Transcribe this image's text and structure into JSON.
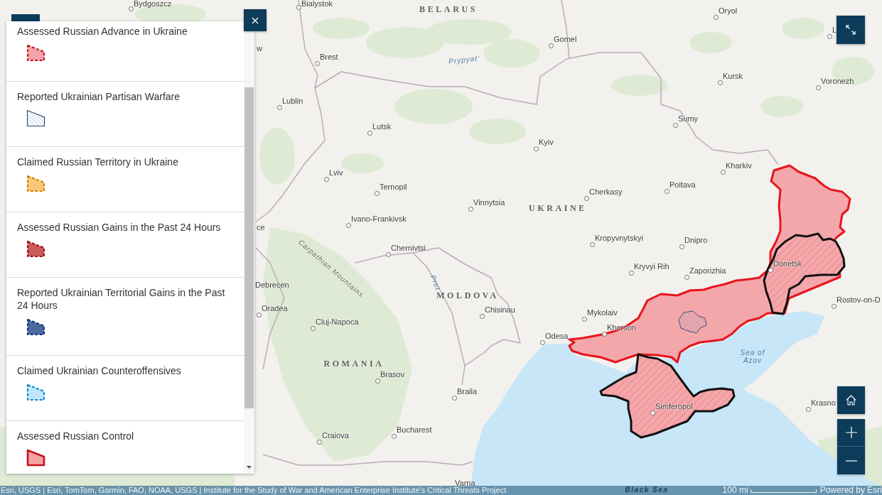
{
  "legend": {
    "items": [
      {
        "label": "Assessed Russian Advance in Ukraine",
        "kind": "dashed",
        "color": "#f4a4a9"
      },
      {
        "label": "Reported Ukrainian Partisan Warfare",
        "kind": "hatched",
        "color": "#344e73"
      },
      {
        "label": "Claimed Russian Territory in Ukraine",
        "kind": "dashed",
        "color": "#fbc776"
      },
      {
        "label": "Assessed Russian Gains in the Past 24 Hours",
        "kind": "dashed",
        "color": "#c95b5d"
      },
      {
        "label": "Reported Ukrainian Territorial Gains in the Past 24 Hours",
        "kind": "dashed",
        "color": "#4d6a9e"
      },
      {
        "label": "Claimed Ukrainian Counteroffensives",
        "kind": "dashed",
        "color": "#bfe6fb"
      },
      {
        "label": "Assessed Russian Control",
        "kind": "solid",
        "color": "#f6a3a6"
      }
    ]
  },
  "map": {
    "labels": [
      {
        "kind": "city",
        "text": "Bydgoszcz"
      },
      {
        "kind": "city",
        "text": "Bialystok"
      },
      {
        "kind": "country",
        "text": "BELARUS"
      },
      {
        "kind": "city",
        "text": "Oryol"
      },
      {
        "kind": "city",
        "text": "L"
      },
      {
        "kind": "city",
        "text": "Gomel"
      },
      {
        "kind": "cut",
        "text": "w"
      },
      {
        "kind": "city",
        "text": "Brest"
      },
      {
        "kind": "water",
        "text": "Prypyat'"
      },
      {
        "kind": "city",
        "text": "Kursk"
      },
      {
        "kind": "city",
        "text": "Voronezh"
      },
      {
        "kind": "city",
        "text": "Lublin"
      },
      {
        "kind": "city",
        "text": "Sumy"
      },
      {
        "kind": "city",
        "text": "Lutsk"
      },
      {
        "kind": "city",
        "text": "Kyiv"
      },
      {
        "kind": "city",
        "text": "Kharkiv"
      },
      {
        "kind": "city",
        "text": "Lviv"
      },
      {
        "kind": "city",
        "text": "Poltava"
      },
      {
        "kind": "city",
        "text": "Ternopil"
      },
      {
        "kind": "city",
        "text": "Cherkasy"
      },
      {
        "kind": "city",
        "text": "Vinnytsia"
      },
      {
        "kind": "country",
        "text": "UKRAINE"
      },
      {
        "kind": "city",
        "text": "Ivano-Frankivsk"
      },
      {
        "kind": "cut",
        "text": "ce"
      },
      {
        "kind": "city",
        "text": "Kropyvnytskyi"
      },
      {
        "kind": "city",
        "text": "Dnipro"
      },
      {
        "kind": "city",
        "text": "Chernivtsi"
      },
      {
        "kind": "terrain",
        "text": "Carpathian Mountains"
      },
      {
        "kind": "city",
        "text": "Donetsk"
      },
      {
        "kind": "city",
        "text": "Kryvyi Rih"
      },
      {
        "kind": "city",
        "text": "Zaporizhia"
      },
      {
        "kind": "water",
        "text": "Prut"
      },
      {
        "kind": "cut",
        "text": "Debrecen"
      },
      {
        "kind": "country",
        "text": "MOLDOVA"
      },
      {
        "kind": "city",
        "text": "Rostov-on-D"
      },
      {
        "kind": "city",
        "text": "Oradea"
      },
      {
        "kind": "city",
        "text": "Chisinau"
      },
      {
        "kind": "city",
        "text": "Mykolaiv"
      },
      {
        "kind": "city",
        "text": "Cluj-Napoca"
      },
      {
        "kind": "city",
        "text": "Kherson"
      },
      {
        "kind": "city",
        "text": "Odesa"
      },
      {
        "kind": "water",
        "text": "Sea of Azov"
      },
      {
        "kind": "country",
        "text": "ROMANIA"
      },
      {
        "kind": "city",
        "text": "Brasov"
      },
      {
        "kind": "city",
        "text": "Braila"
      },
      {
        "kind": "city",
        "text": "Krasno"
      },
      {
        "kind": "city",
        "text": "Simferopol"
      },
      {
        "kind": "city",
        "text": "Bucharest"
      },
      {
        "kind": "city",
        "text": "Craiova"
      },
      {
        "kind": "cut",
        "text": "Varna"
      },
      {
        "kind": "sea",
        "text": "Black Sea"
      }
    ]
  },
  "attribution": {
    "text": "Esri, USGS | Esri, TomTom, Garmin, FAO, NOAA, USGS | Institute for the Study of War and American Enterprise Institute's Critical Threats Project",
    "scale": "100 mi",
    "powered_by": "Powered by Esri"
  }
}
